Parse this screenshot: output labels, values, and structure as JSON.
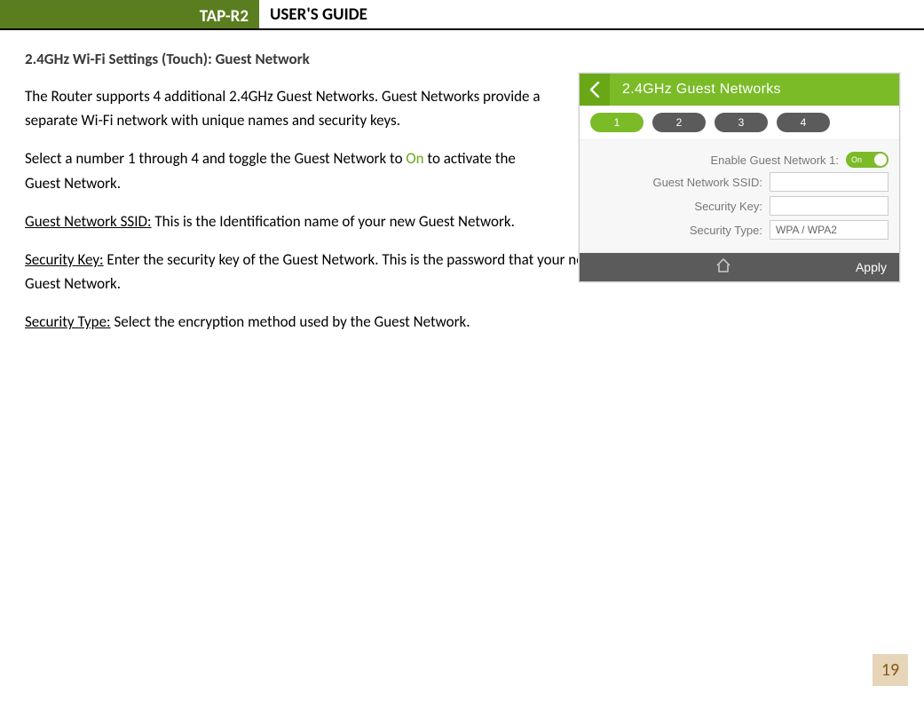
{
  "header": {
    "model": "TAP-R2",
    "title": "USER'S GUIDE"
  },
  "section_title": "2.4GHz Wi-Fi Settings (Touch): Guest Network",
  "paras": {
    "intro": "The Router supports 4 additional 2.4GHz Guest Networks.  Guest Networks provide a separate Wi-Fi network with unique names and security keys.",
    "select_pre": "Select a number 1 through 4 and toggle the Guest Network to ",
    "select_on": "On",
    "select_post": " to activate the Guest Network.",
    "ssid_label": "Guest Network SSID:",
    "ssid_text": " This is the Identification name of your new Guest Network.",
    "seckey_label": "Security Key:",
    "seckey_text": " Enter the security key of the Guest Network. This is the password that your network devices will use to connect your new Guest Network.",
    "sectype_label": "Security Type:",
    "sectype_text": " Select the encryption method used by the Guest Network."
  },
  "screenshot": {
    "title": "2.4GHz Guest Networks",
    "tabs": [
      "1",
      "2",
      "3",
      "4"
    ],
    "enable_label": "Enable Guest Network 1:",
    "toggle_text": "On",
    "ssid_label": "Guest Network SSID:",
    "key_label": "Security Key:",
    "type_label": "Security Type:",
    "type_value": "WPA / WPA2",
    "apply": "Apply"
  },
  "page_number": "19"
}
